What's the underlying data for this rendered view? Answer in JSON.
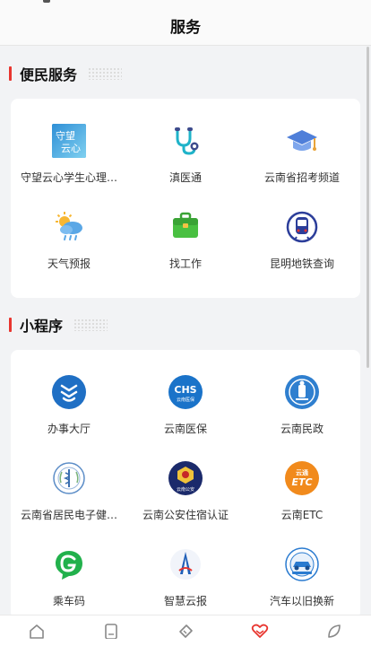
{
  "header": {
    "title": "服务"
  },
  "sections": [
    {
      "title": "便民服务",
      "items": [
        {
          "label": "守望云心学生心理…",
          "icon": "shouwang-yun-logo-icon"
        },
        {
          "label": "滇医通",
          "icon": "stethoscope-icon"
        },
        {
          "label": "云南省招考频道",
          "icon": "graduation-cap-icon"
        },
        {
          "label": "天气预报",
          "icon": "weather-sun-cloud-icon"
        },
        {
          "label": "找工作",
          "icon": "briefcase-icon"
        },
        {
          "label": "昆明地铁查询",
          "icon": "metro-train-icon"
        }
      ]
    },
    {
      "title": "小程序",
      "items": [
        {
          "label": "办事大厅",
          "icon": "service-hall-icon"
        },
        {
          "label": "云南医保",
          "icon": "chs-medical-insurance-icon",
          "badge_text": "CHS",
          "badge_sub": "云南医保"
        },
        {
          "label": "云南民政",
          "icon": "civil-affairs-icon"
        },
        {
          "label": "云南省居民电子健…",
          "icon": "health-card-emblem-icon"
        },
        {
          "label": "云南公安住宿认证",
          "icon": "police-emblem-icon",
          "badge_sub": "云南公安"
        },
        {
          "label": "云南ETC",
          "icon": "etc-icon",
          "badge_top": "云通",
          "badge_text": "ETC"
        },
        {
          "label": "乘车码",
          "icon": "ride-code-g-icon"
        },
        {
          "label": "智慧云报",
          "icon": "smart-yunbao-icon"
        },
        {
          "label": "汽车以旧换新",
          "icon": "car-trade-in-icon"
        }
      ]
    }
  ],
  "tabbar": [
    {
      "icon": "home-icon",
      "active": false
    },
    {
      "icon": "document-icon",
      "active": false
    },
    {
      "icon": "ticket-icon",
      "active": false
    },
    {
      "icon": "heart-service-icon",
      "active": true
    },
    {
      "icon": "leaf-icon",
      "active": false
    }
  ],
  "colors": {
    "accent": "#e8352f",
    "blue": "#1a73c9",
    "red_tab": "#e8352f"
  }
}
